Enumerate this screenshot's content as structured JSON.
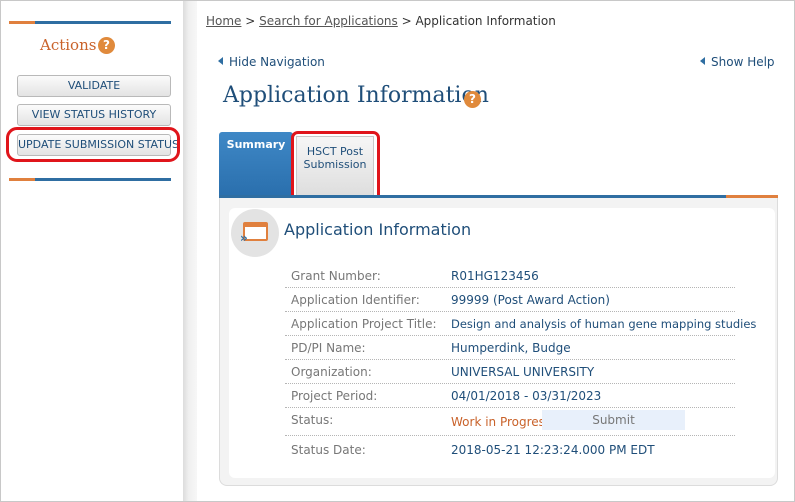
{
  "sidebar": {
    "title": "Actions",
    "help_label": "?",
    "buttons": {
      "validate": "VALIDATE",
      "view_status_history": "VIEW STATUS HISTORY",
      "update_submission_status": "UPDATE SUBMISSION STATUS"
    }
  },
  "breadcrumb": {
    "home": "Home",
    "sep1": " > ",
    "search": "Search for Applications",
    "sep2": " > ",
    "current": "Application Information"
  },
  "nav": {
    "hide_navigation": "Hide Navigation",
    "show_help": "Show Help"
  },
  "page": {
    "title": "Application Information",
    "help_label": "?"
  },
  "tabs": {
    "summary": "Summary",
    "hsct_line1": "HSCT Post",
    "hsct_line2": "Submission"
  },
  "card": {
    "title": "Application Information",
    "rows": [
      {
        "label": "Grant Number:",
        "value": "R01HG123456"
      },
      {
        "label": "Application Identifier:",
        "value": "99999 (Post Award Action)"
      },
      {
        "label": "Application Project Title:",
        "value": "Design and analysis of human gene mapping studies"
      },
      {
        "label": "PD/PI Name:",
        "value": "Humperdink, Budge"
      },
      {
        "label": "Organization:",
        "value": "UNIVERSAL UNIVERSITY"
      },
      {
        "label": "Project Period:",
        "value": "04/01/2018 - 03/31/2023"
      },
      {
        "label": "Status:",
        "value": "Work in Progress"
      },
      {
        "label": "Status Date:",
        "value": "2018-05-21 12:23:24.000 PM EDT"
      }
    ],
    "submit_label": "Submit"
  },
  "colors": {
    "accent_orange": "#e0803e",
    "brand_blue": "#1f4e79",
    "highlight_red": "#e0151b"
  }
}
